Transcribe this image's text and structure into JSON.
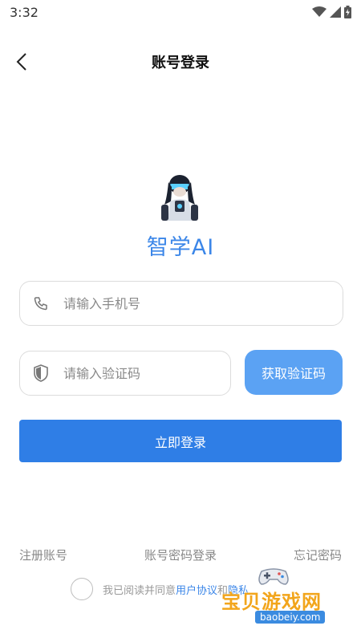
{
  "status": {
    "time": "3:32"
  },
  "header": {
    "title": "账号登录"
  },
  "app": {
    "name": "智学AI"
  },
  "form": {
    "phone_placeholder": "请输入手机号",
    "code_placeholder": "请输入验证码",
    "get_code_label": "获取验证码",
    "login_label": "立即登录"
  },
  "links": {
    "register": "注册账号",
    "password_login": "账号密码登录",
    "forgot": "忘记密码"
  },
  "agreement": {
    "prefix": "我已阅读并同意",
    "user_agreement": "用户协议",
    "and": "和",
    "privacy": "隐私"
  },
  "watermark": {
    "title": "宝贝游戏网",
    "url": "baobeiy.com"
  },
  "colors": {
    "accent": "#2f7ee6",
    "code_button": "#5ba2f3",
    "brand_text": "#3b86e8"
  }
}
